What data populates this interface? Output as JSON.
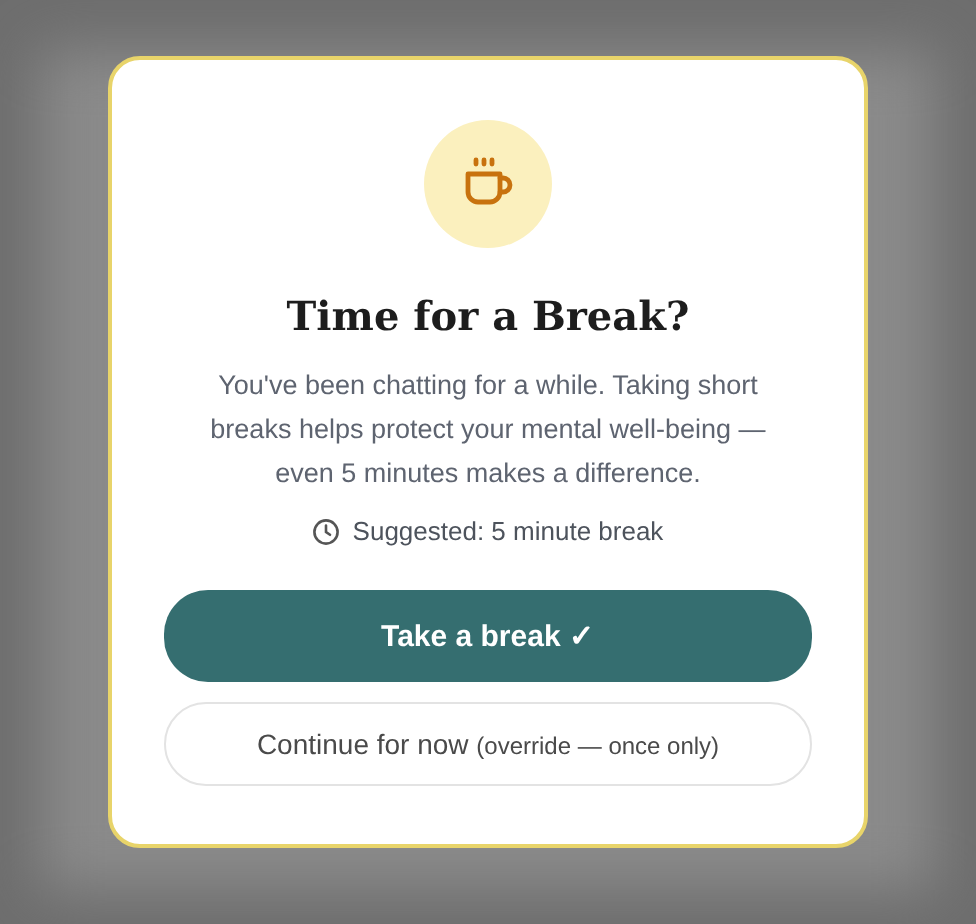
{
  "dialog": {
    "title": "Time for a Break?",
    "message": "You've been chatting for a while. Taking short breaks helps protect your mental well-being — even 5 minutes makes a difference.",
    "suggestion": "Suggested: 5 minute break",
    "primary_button": {
      "label": "Take a break ✓"
    },
    "secondary_button": {
      "label": "Continue for now",
      "note": "(override — once only)"
    }
  }
}
